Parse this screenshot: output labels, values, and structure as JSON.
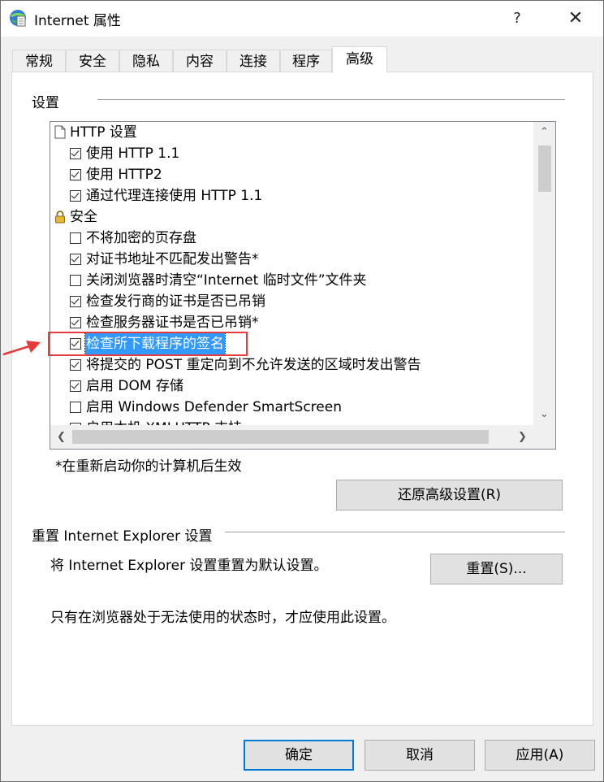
{
  "window": {
    "title": "Internet 属性",
    "help_glyph": "?",
    "close_glyph": "✕"
  },
  "tabs": [
    {
      "label": "常规"
    },
    {
      "label": "安全"
    },
    {
      "label": "隐私"
    },
    {
      "label": "内容"
    },
    {
      "label": "连接"
    },
    {
      "label": "程序"
    },
    {
      "label": "高级",
      "active": true
    }
  ],
  "settings": {
    "group_label": "设置",
    "rows": [
      {
        "type": "group",
        "icon": "page-icon",
        "label": "HTTP 设置"
      },
      {
        "type": "checkbox",
        "checked": true,
        "label": "使用 HTTP 1.1"
      },
      {
        "type": "checkbox",
        "checked": true,
        "label": "使用 HTTP2"
      },
      {
        "type": "checkbox",
        "checked": true,
        "label": "通过代理连接使用 HTTP 1.1"
      },
      {
        "type": "group",
        "icon": "lock-icon",
        "label": "安全"
      },
      {
        "type": "checkbox",
        "checked": false,
        "label": "不将加密的页存盘"
      },
      {
        "type": "checkbox",
        "checked": true,
        "label": "对证书地址不匹配发出警告*"
      },
      {
        "type": "checkbox",
        "checked": false,
        "label": "关闭浏览器时清空“Internet 临时文件”文件夹"
      },
      {
        "type": "checkbox",
        "checked": true,
        "label": "检查发行商的证书是否已吊销"
      },
      {
        "type": "checkbox",
        "checked": true,
        "label": "检查服务器证书是否已吊销*"
      },
      {
        "type": "checkbox",
        "checked": true,
        "label": "检查所下载程序的签名",
        "selected": true
      },
      {
        "type": "checkbox",
        "checked": true,
        "label": "将提交的 POST 重定向到不允许发送的区域时发出警告"
      },
      {
        "type": "checkbox",
        "checked": true,
        "label": "启用 DOM 存储"
      },
      {
        "type": "checkbox",
        "checked": false,
        "label": "启用 Windows Defender SmartScreen"
      },
      {
        "type": "checkbox",
        "checked": true,
        "label": "启用本机 XMLHTTP 支持"
      }
    ],
    "restart_note": "*在重新启动你的计算机后生效",
    "restore_button": "还原高级设置(R)"
  },
  "reset": {
    "group_label": "重置 Internet Explorer 设置",
    "description": "将 Internet Explorer 设置重置为默认设置。",
    "reset_button": "重置(S)...",
    "warning": "只有在浏览器处于无法使用的状态时，才应使用此设置。"
  },
  "footer": {
    "ok": "确定",
    "cancel": "取消",
    "apply": "应用(A)"
  },
  "colors": {
    "selection": "#3399ff",
    "annotation": "#e43b3b",
    "default_button_border": "#0078d7"
  }
}
